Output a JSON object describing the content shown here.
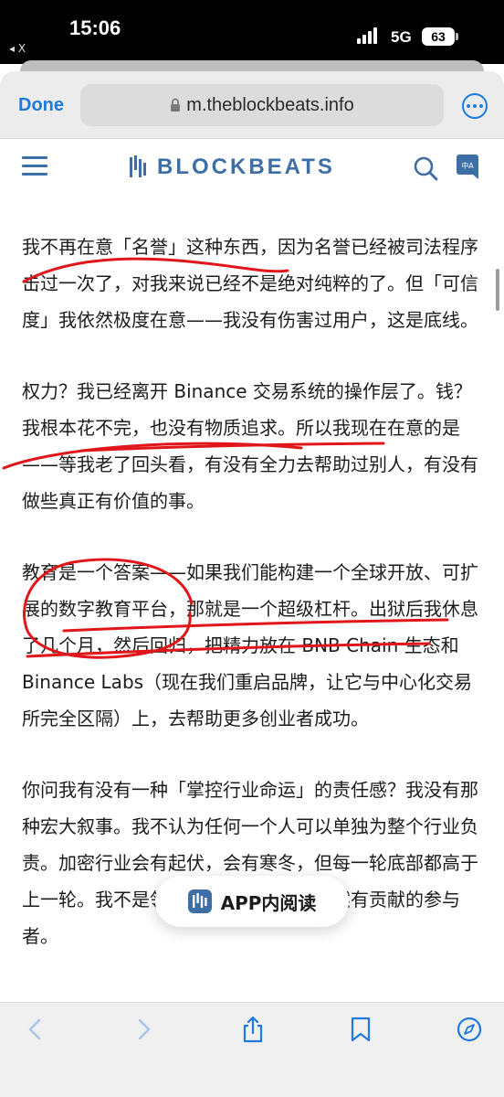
{
  "status_bar": {
    "time": "15:06",
    "back_app": "◂ X",
    "network": "5G",
    "battery": "63"
  },
  "browser": {
    "done_label": "Done",
    "url": "m.theblockbeats.info"
  },
  "site": {
    "logo_text": "BLOCKBEATS",
    "translate_glyph": "中A"
  },
  "article": {
    "paragraphs": [
      "我不再在意「名誉」这种东西，因为名誉已经被司法程序击过一次了，对我来说已经不是绝对纯粹的了。但「可信度」我依然极度在意——我没有伤害过用户，这是底线。",
      "权力？我已经离开 Binance 交易系统的操作层了。钱？我根本花不完，也没有物质追求。所以我现在在意的是——等我老了回头看，有没有全力去帮助过别人，有没有做些真正有价值的事。",
      "教育是一个答案——如果我们能构建一个全球开放、可扩展的数字教育平台，那就是一个超级杠杆。出狱后我休息了几个月，然后回归，把精力放在 BNB Chain 生态和 Binance Labs（现在我们重启品牌，让它与中心化交易所完全区隔）上，去帮助更多创业者成功。",
      "你问我有没有一种「掌控行业命运」的责任感？我没有那种宏大叙事。我不认为任何一个人可以单独为整个行业负责。加密行业会有起伏，会有寒冬，但每一轮底部都高于上一轮。我不是领袖，我只是一个很偶然有贡献的参与者。"
    ]
  },
  "app_banner": {
    "label": "APP内阅读"
  },
  "colors": {
    "link_blue": "#1f7ae0",
    "brand_blue": "#3d6ea6",
    "annotation_red": "#e0161a"
  }
}
